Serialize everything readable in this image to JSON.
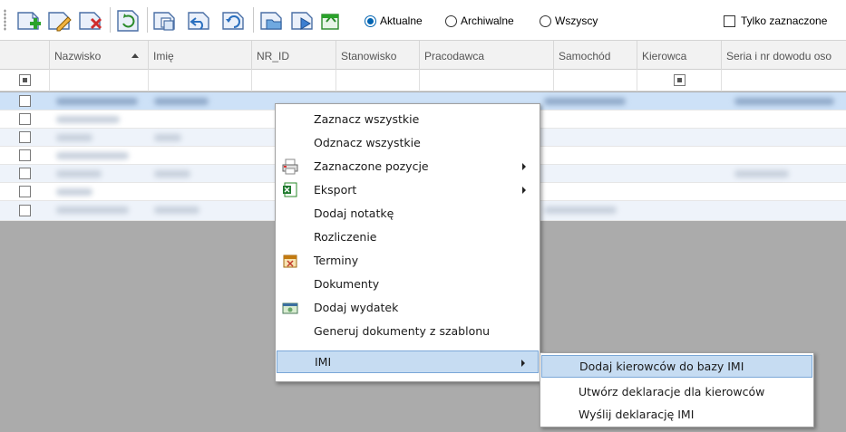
{
  "toolbar": {
    "buttons": [
      {
        "name": "add-record-icon"
      },
      {
        "name": "edit-record-icon"
      },
      {
        "name": "delete-record-icon"
      },
      {
        "name": "refresh-icon"
      },
      {
        "name": "copy-record-icon"
      },
      {
        "name": "undo-record-icon"
      },
      {
        "name": "restore-record-icon"
      },
      {
        "name": "folder-open-icon"
      },
      {
        "name": "forward-record-icon"
      },
      {
        "name": "export-green-icon"
      }
    ],
    "filter_options": [
      {
        "label": "Aktualne",
        "checked": true
      },
      {
        "label": "Archiwalne",
        "checked": false
      },
      {
        "label": "Wszyscy",
        "checked": false
      }
    ],
    "only_selected_label": "Tylko zaznaczone"
  },
  "grid": {
    "columns": [
      "Nazwisko",
      "Imię",
      "NR_ID",
      "Stanowisko",
      "Pracodawca",
      "Samochód",
      "Kierowca",
      "Seria i nr dowodu oso"
    ],
    "sort_column": "Nazwisko",
    "sort_direction": "ascending",
    "row_count": 7
  },
  "context_menu": {
    "items": [
      {
        "label": "Zaznacz wszystkie",
        "icon": null,
        "submenu": false
      },
      {
        "label": "Odznacz wszystkie",
        "icon": null,
        "submenu": false
      },
      {
        "label": "Zaznaczone pozycje",
        "icon": "print-icon",
        "submenu": true
      },
      {
        "label": "Eksport",
        "icon": "excel-icon",
        "submenu": true
      },
      {
        "label": "Dodaj notatkę",
        "icon": null,
        "submenu": false
      },
      {
        "label": "Rozliczenie",
        "icon": null,
        "submenu": false
      },
      {
        "label": "Terminy",
        "icon": "calendar-icon",
        "submenu": false
      },
      {
        "label": "Dokumenty",
        "icon": null,
        "submenu": false
      },
      {
        "label": "Dodaj wydatek",
        "icon": "money-icon",
        "submenu": false
      },
      {
        "label": "Generuj dokumenty z szablonu",
        "icon": null,
        "submenu": false
      },
      {
        "label": "IMI",
        "icon": null,
        "submenu": true,
        "highlighted": true
      }
    ]
  },
  "submenu": {
    "items": [
      {
        "label": "Dodaj kierowców do bazy IMI",
        "highlighted": true
      },
      {
        "label": "Utwórz deklaracje dla kierowców",
        "highlighted": false
      },
      {
        "label": "Wyślij deklarację IMI",
        "highlighted": false
      }
    ]
  },
  "colors": {
    "accent": "#0063b1",
    "menu_highlight": "#c6dcf2",
    "selected_row": "#cde1f7",
    "empty_area": "#ababab"
  }
}
